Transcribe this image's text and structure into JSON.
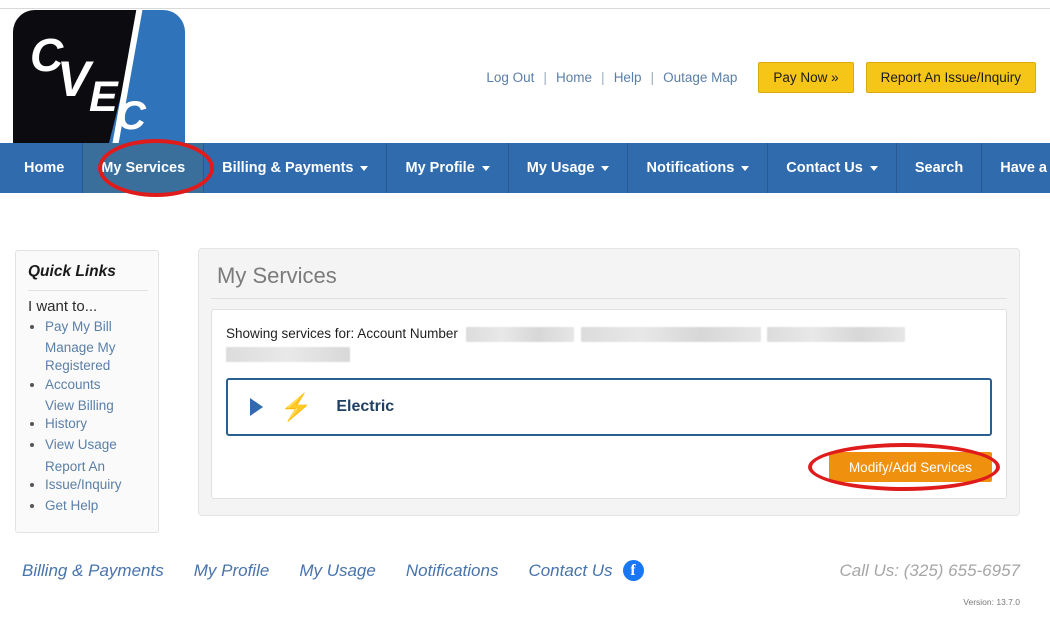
{
  "brand": {
    "logo_text": "CVEC",
    "logo_letters": [
      "C",
      "V",
      "E",
      "C"
    ]
  },
  "utility_bar": {
    "links": [
      {
        "label": "Log Out"
      },
      {
        "label": "Home"
      },
      {
        "label": "Help"
      },
      {
        "label": "Outage Map"
      }
    ],
    "separator": "|",
    "buttons": [
      {
        "label": "Pay Now »",
        "color": "#f5c518"
      },
      {
        "label": "Report An Issue/Inquiry",
        "color": "#f5c518"
      }
    ]
  },
  "nav": {
    "active": "My Services",
    "background": "#2f6bad",
    "active_background": "#3a6f9c",
    "items": [
      {
        "label": "Home",
        "has_caret": false
      },
      {
        "label": "My Services",
        "has_caret": false
      },
      {
        "label": "Billing & Payments",
        "has_caret": true
      },
      {
        "label": "My Profile",
        "has_caret": true
      },
      {
        "label": "My Usage",
        "has_caret": true
      },
      {
        "label": "Notifications",
        "has_caret": true
      },
      {
        "label": "Contact Us",
        "has_caret": true
      },
      {
        "label": "Search",
        "has_caret": false
      },
      {
        "label": "Have a Question",
        "has_caret": false
      }
    ]
  },
  "quick_links": {
    "title": "Quick Links",
    "subtitle": "I want to...",
    "items": [
      {
        "label": "Pay My Bill"
      },
      {
        "label": "Manage My Registered Accounts"
      },
      {
        "label": "View Billing History"
      },
      {
        "label": "View Usage"
      },
      {
        "label": "Report An Issue/Inquiry"
      },
      {
        "label": "Get Help"
      }
    ]
  },
  "main": {
    "title": "My Services",
    "showing_label": "Showing services for: Account Number",
    "account_number": "",
    "account_name": "",
    "service": {
      "label": "Electric",
      "expanded": false,
      "icon": "lightning-bolt",
      "border_color": "#2b5f8f"
    },
    "modify_button": {
      "label": "Modify/Add Services",
      "color": "#f0900f"
    }
  },
  "footer": {
    "links": [
      {
        "label": "Billing & Payments"
      },
      {
        "label": "My Profile"
      },
      {
        "label": "My Usage"
      },
      {
        "label": "Notifications"
      },
      {
        "label": "Contact Us"
      }
    ],
    "social": {
      "name": "facebook",
      "glyph": "f"
    },
    "call_us": "Call Us: (325) 655-6957",
    "version": "Version: 13.7.0"
  },
  "annotations": [
    {
      "target": "My Services",
      "shape": "ellipse",
      "color": "#e01b1b"
    },
    {
      "target": "Modify/Add Services",
      "shape": "ellipse",
      "color": "#e01b1b"
    }
  ]
}
